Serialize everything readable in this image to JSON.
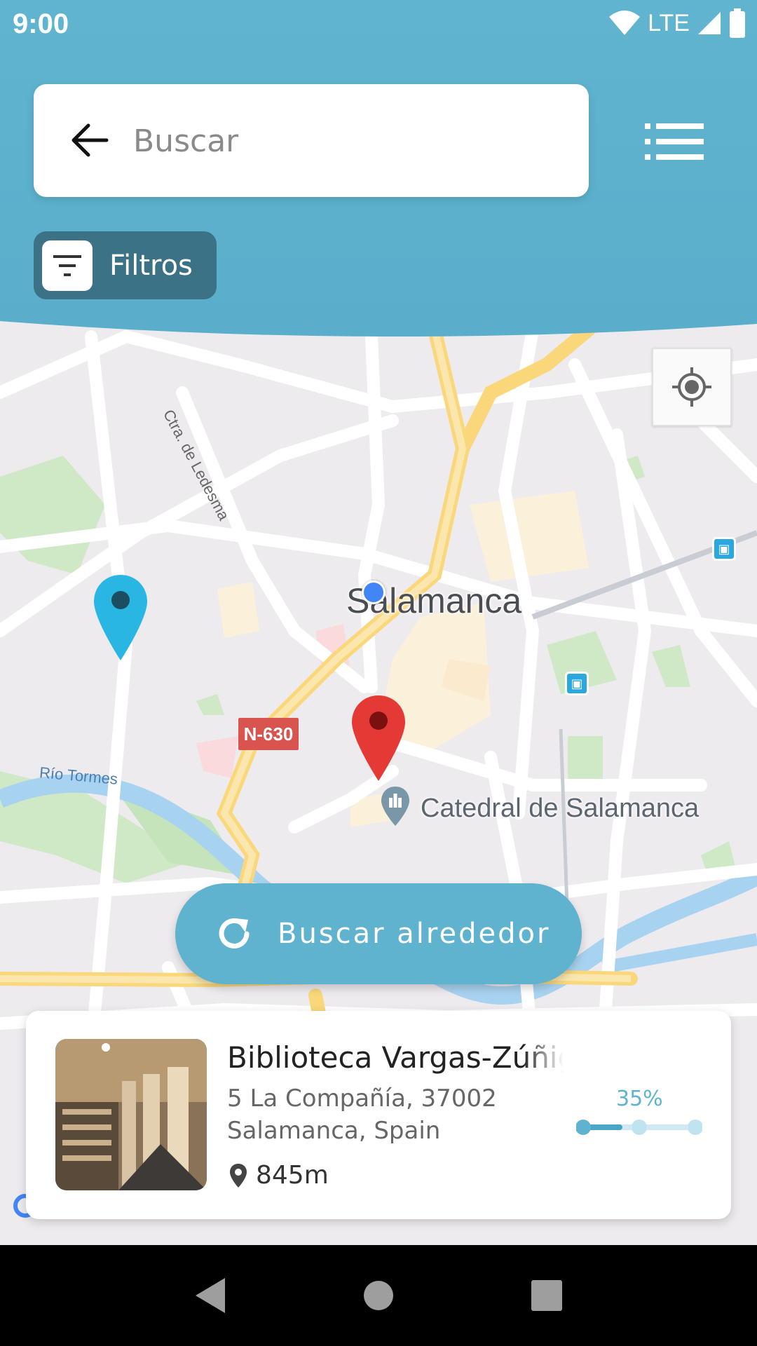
{
  "status_bar": {
    "time": "9:00",
    "network": "LTE",
    "icons": [
      "wifi-icon",
      "signal-icon",
      "battery-icon"
    ]
  },
  "search": {
    "placeholder": "Buscar",
    "back_icon": "arrow-back-icon",
    "list_icon": "list-view-icon"
  },
  "filters": {
    "label": "Filtros",
    "icon": "filter-icon"
  },
  "map": {
    "city_label": "Salamanca",
    "poi_label": "Catedral de Salamanca",
    "road_label": "Ctra. de Ledesma",
    "river_label": "Río Tormes",
    "route_shield": "N-630",
    "locate_icon": "my-location-icon"
  },
  "nearby_button": {
    "label": "Buscar alrededor",
    "icon": "refresh-icon"
  },
  "place_card": {
    "title": "Biblioteca Vargas-Zúñiga",
    "address_line1": "5 La Compañía, 37002",
    "address_line2": "Salamanca, Spain",
    "distance": "845m",
    "occupancy_label": "35%",
    "occupancy_fraction": 0.35
  },
  "colors": {
    "header": "#5fb3cf",
    "filter_button": "#3b7285",
    "accent": "#5fb3cf",
    "marker_red": "#e53935",
    "marker_blue": "#2ab6e3"
  },
  "nav_bar": {
    "buttons": [
      "back-nav-icon",
      "home-nav-icon",
      "recents-nav-icon"
    ]
  }
}
